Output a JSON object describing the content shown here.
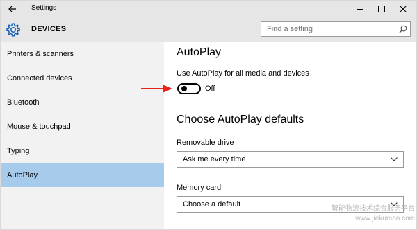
{
  "window": {
    "title": "Settings"
  },
  "header": {
    "section_title": "DEVICES",
    "search_placeholder": "Find a setting"
  },
  "sidebar": {
    "items": [
      {
        "label": "Printers & scanners"
      },
      {
        "label": "Connected devices"
      },
      {
        "label": "Bluetooth"
      },
      {
        "label": "Mouse & touchpad"
      },
      {
        "label": "Typing"
      },
      {
        "label": "AutoPlay",
        "selected": true
      }
    ]
  },
  "main": {
    "autoplay_heading": "AutoPlay",
    "toggle_label": "Use AutoPlay for all media and devices",
    "toggle_state": "Off",
    "toggle_on": false,
    "defaults_heading": "Choose AutoPlay defaults",
    "removable_drive": {
      "label": "Removable drive",
      "value": "Ask me every time"
    },
    "memory_card": {
      "label": "Memory card",
      "value": "Choose a default"
    }
  },
  "watermark": {
    "line1": "智能物流技术综合服务平台",
    "line2": "www.jiekumao.com"
  },
  "colors": {
    "sidebar_bg": "#f2f2f2",
    "selected_bg": "#a7cbea",
    "titlebar_bg": "#e6e6e6",
    "annotation_arrow": "#e8231b"
  },
  "icons": {
    "back": "back-arrow-icon",
    "minimize": "minimize-icon",
    "maximize": "maximize-icon",
    "close": "close-icon",
    "section": "gear-icon",
    "search": "search-icon",
    "dropdown": "chevron-down-icon",
    "annotation": "red-arrow-icon"
  }
}
